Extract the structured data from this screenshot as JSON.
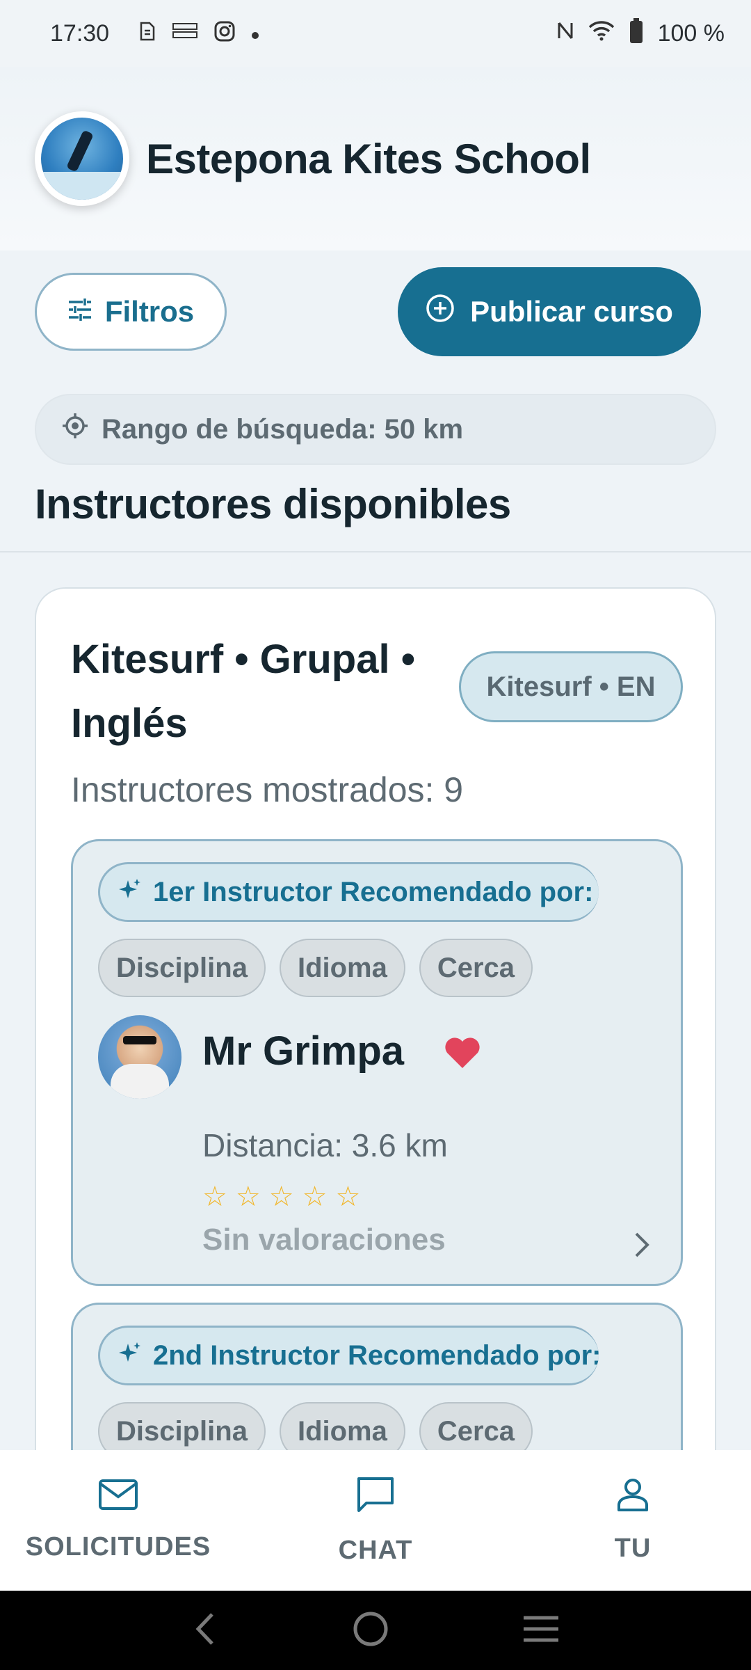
{
  "status_bar": {
    "time": "17:30",
    "battery": "100 %",
    "icons": [
      "sim-icon",
      "temu-icon",
      "instagram-icon",
      "dot-icon",
      "nfc-icon",
      "wifi-icon",
      "battery-icon"
    ]
  },
  "header": {
    "title": "Estepona Kites School",
    "logo": "school-logo"
  },
  "actions": {
    "filters_label": "Filtros",
    "publish_label": "Publicar curso"
  },
  "search_range": {
    "label": "Rango de búsqueda: 50 km"
  },
  "section": {
    "title": "Instructores disponibles"
  },
  "course": {
    "title": "Kitesurf • Grupal • Inglés",
    "badge": "Kitesurf • EN",
    "shown_count": "Instructores mostrados: 9",
    "instructors": [
      {
        "recommendation": "1er Instructor Recomendado por:",
        "tags": [
          "Disciplina",
          "Idioma",
          "Cerca"
        ],
        "name": "Mr Grimpa",
        "favorite": true,
        "distance": "Distancia: 3.6 km",
        "stars": [
          "☆",
          "☆",
          "☆",
          "☆",
          "☆"
        ],
        "rating_count": 0,
        "ratings_text": "Sin valoraciones"
      },
      {
        "recommendation": "2nd Instructor Recomendado por:",
        "tags": [
          "Disciplina",
          "Idioma",
          "Cerca"
        ]
      }
    ]
  },
  "bottom_nav": {
    "items": [
      {
        "label": "SOLICITUDES",
        "icon": "mail-icon"
      },
      {
        "label": "CHAT",
        "icon": "chat-icon"
      },
      {
        "label": "TU",
        "icon": "person-icon"
      }
    ]
  },
  "colors": {
    "primary": "#176f91",
    "background": "#eef3f7",
    "star": "#f1b62a",
    "heart": "#e2445c"
  }
}
